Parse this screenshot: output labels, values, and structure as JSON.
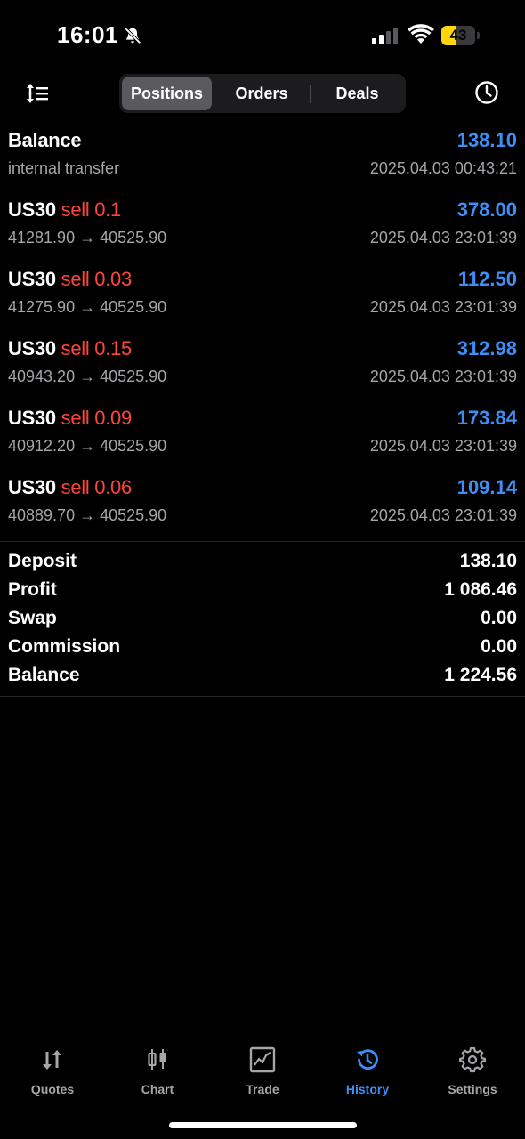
{
  "status_bar": {
    "time": "16:01",
    "battery": "43",
    "battery_level": 0.43,
    "battery_color": "#ffd60a"
  },
  "toolbar": {
    "tabs": [
      {
        "label": "Positions",
        "active": true
      },
      {
        "label": "Orders",
        "active": false
      },
      {
        "label": "Deals",
        "active": false
      }
    ]
  },
  "colors": {
    "accent_blue": "#3d8ff5",
    "sell_red": "#ff453a",
    "muted_text": "#a5a5aa",
    "background": "#000000"
  },
  "balance_entry": {
    "title": "Balance",
    "amount": "138.10",
    "comment": "internal transfer",
    "time": "2025.04.03 00:43:21"
  },
  "positions": [
    {
      "symbol": "US30",
      "side": "sell",
      "volume": "0.1",
      "profit": "378.00",
      "prices": "41281.90 → 40525.90",
      "time": "2025.04.03 23:01:39"
    },
    {
      "symbol": "US30",
      "side": "sell",
      "volume": "0.03",
      "profit": "112.50",
      "prices": "41275.90 → 40525.90",
      "time": "2025.04.03 23:01:39"
    },
    {
      "symbol": "US30",
      "side": "sell",
      "volume": "0.15",
      "profit": "312.98",
      "prices": "40943.20 → 40525.90",
      "time": "2025.04.03 23:01:39"
    },
    {
      "symbol": "US30",
      "side": "sell",
      "volume": "0.09",
      "profit": "173.84",
      "prices": "40912.20 → 40525.90",
      "time": "2025.04.03 23:01:39"
    },
    {
      "symbol": "US30",
      "side": "sell",
      "volume": "0.06",
      "profit": "109.14",
      "prices": "40889.70 → 40525.90",
      "time": "2025.04.03 23:01:39"
    }
  ],
  "summary": [
    {
      "label": "Deposit",
      "value": "138.10"
    },
    {
      "label": "Profit",
      "value": "1 086.46"
    },
    {
      "label": "Swap",
      "value": "0.00"
    },
    {
      "label": "Commission",
      "value": "0.00"
    },
    {
      "label": "Balance",
      "value": "1 224.56"
    }
  ],
  "tabbar": {
    "items": [
      {
        "label": "Quotes",
        "icon": "quotes-arrows-icon",
        "active": false
      },
      {
        "label": "Chart",
        "icon": "candlestick-chart-icon",
        "active": false
      },
      {
        "label": "Trade",
        "icon": "trade-chart-icon",
        "active": false
      },
      {
        "label": "History",
        "icon": "history-clock-icon",
        "active": true
      },
      {
        "label": "Settings",
        "icon": "gear-icon",
        "active": false
      }
    ]
  }
}
